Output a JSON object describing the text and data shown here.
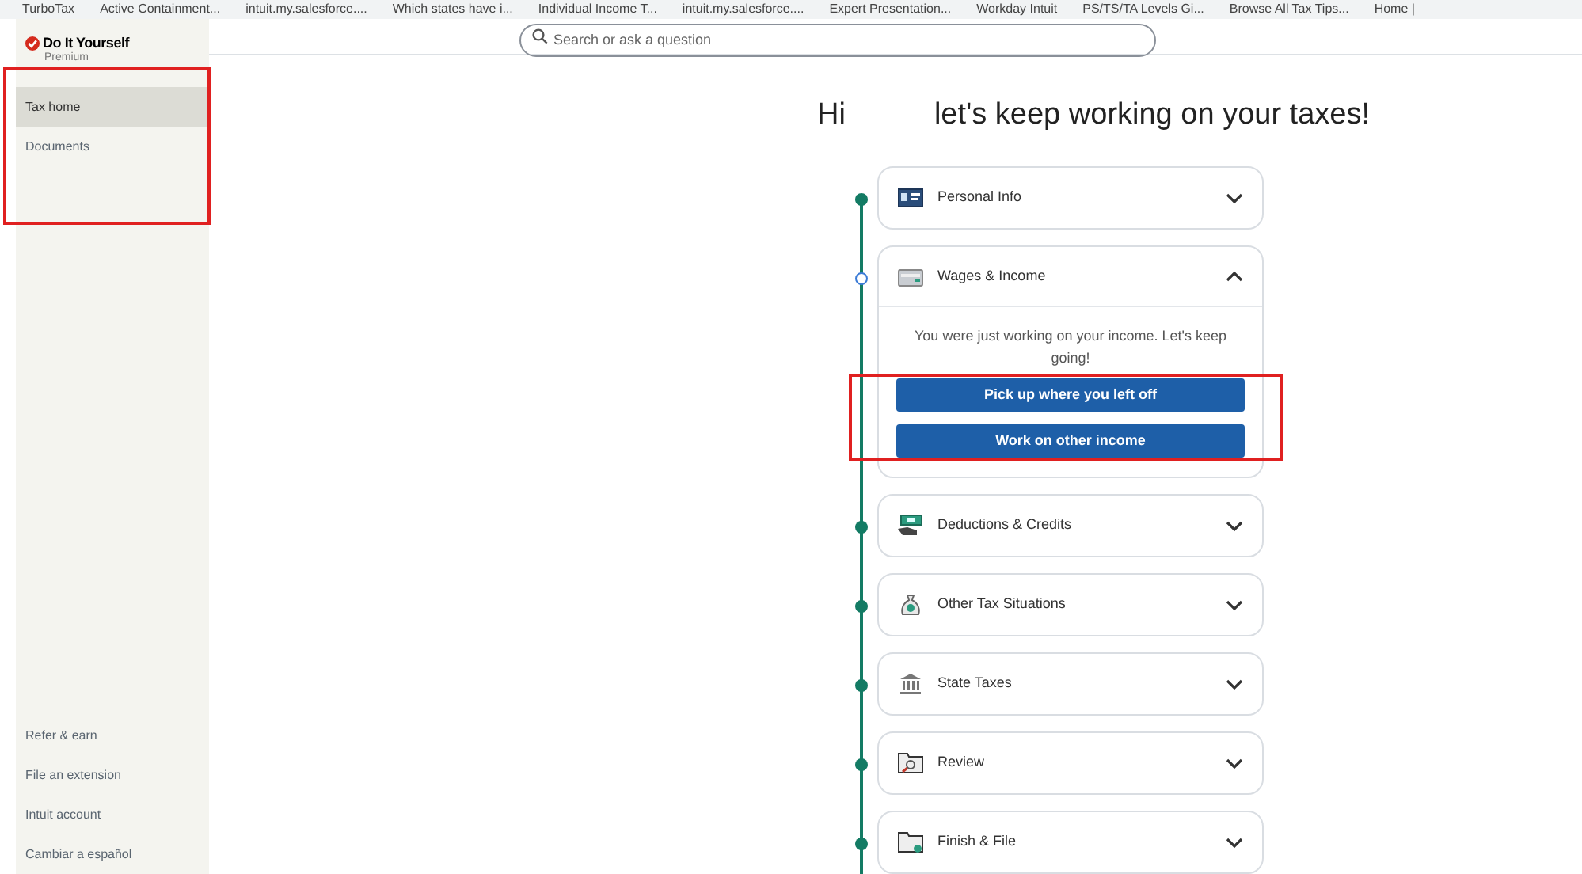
{
  "bookmarks": [
    "TurboTax",
    "Active Containment...",
    "intuit.my.salesforce....",
    "Which states have i...",
    "Individual Income T...",
    "intuit.my.salesforce....",
    "Expert Presentation...",
    "Workday Intuit",
    "PS/TS/TA Levels Gi...",
    "Browse All Tax Tips...",
    "Home |"
  ],
  "brand": {
    "name": "Do It Yourself",
    "tier": "Premium"
  },
  "sidebar": {
    "items": [
      {
        "label": "Tax home",
        "selected": true
      },
      {
        "label": "Documents",
        "selected": false
      }
    ],
    "footer_items": [
      "Refer & earn",
      "File an extension",
      "Intuit account",
      "Cambiar a español"
    ]
  },
  "search": {
    "placeholder": "Search or ask a question"
  },
  "greeting": {
    "hi": "Hi",
    "message": "let's keep working on your taxes!"
  },
  "sections": [
    {
      "title": "Personal Info",
      "completed": true,
      "expanded": false
    },
    {
      "title": "Wages & Income",
      "completed": false,
      "expanded": true,
      "message": "You were just working on your income. Let's keep going!",
      "buttons": [
        "Pick up where you left off",
        "Work on other income"
      ]
    },
    {
      "title": "Deductions & Credits",
      "completed": true,
      "expanded": false
    },
    {
      "title": "Other Tax Situations",
      "completed": true,
      "expanded": false
    },
    {
      "title": "State Taxes",
      "completed": true,
      "expanded": false
    },
    {
      "title": "Review",
      "completed": true,
      "expanded": false
    },
    {
      "title": "Finish & File",
      "completed": true,
      "expanded": false
    }
  ]
}
